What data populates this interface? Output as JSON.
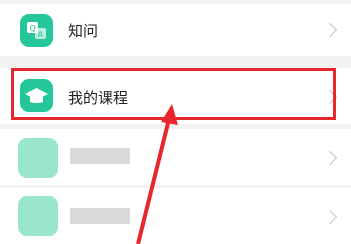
{
  "list": {
    "items": [
      {
        "label": "知问",
        "icon": "qa-icon"
      },
      {
        "label": "我的课程",
        "icon": "graduation-cap-icon"
      },
      {
        "label": "",
        "icon": "blurred-icon"
      },
      {
        "label": "",
        "icon": "blurred-icon"
      }
    ]
  },
  "colors": {
    "accent": "#24C79A",
    "highlight": "#E8262D",
    "background": "#F2F2F2",
    "chevron": "#C4C4C4"
  }
}
